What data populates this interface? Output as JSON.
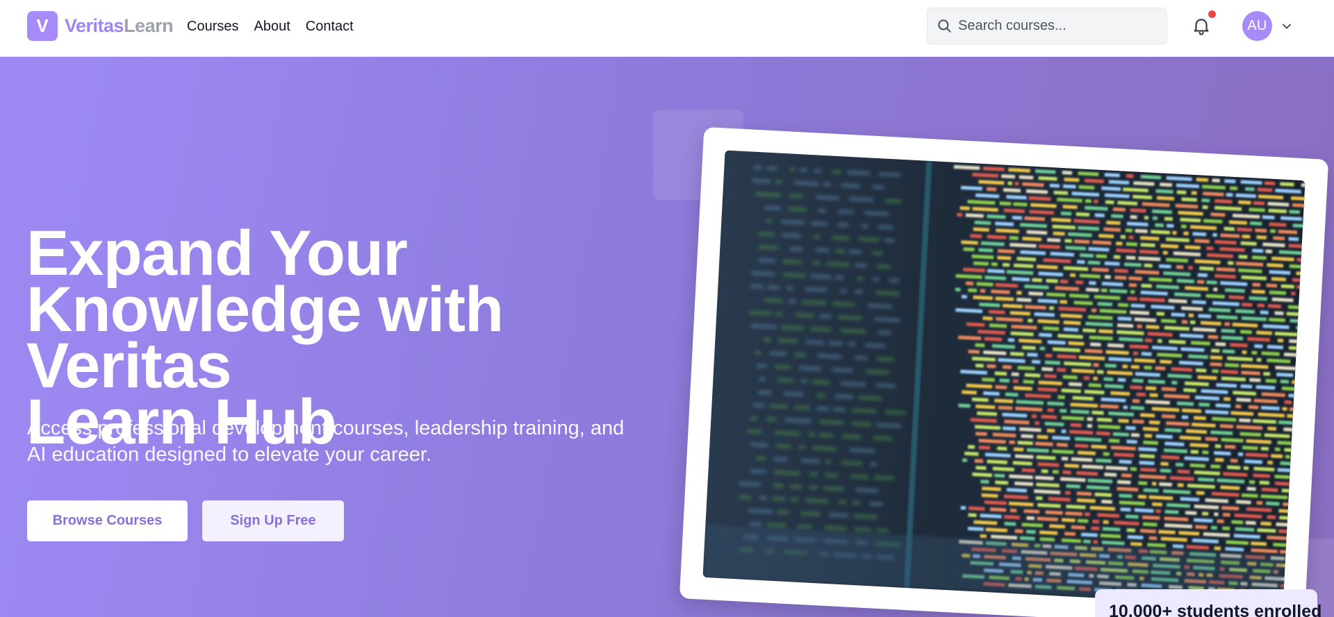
{
  "header": {
    "logo_letter": "V",
    "logo_part1": "Veritas",
    "logo_part2": "Learn",
    "nav": [
      "Courses",
      "About",
      "Contact"
    ],
    "search_placeholder": "Search courses...",
    "avatar_initials": "AU",
    "icons": [
      "search-icon",
      "bell-icon",
      "chevron-down-icon"
    ]
  },
  "hero": {
    "title_lines": [
      "Expand Your",
      "Knowledge with Veritas",
      "Learn Hub"
    ],
    "subtitle": "Access professional development courses, leadership training, and AI education designed to elevate your career.",
    "browse_label": "Browse Courses",
    "signup_label": "Sign Up Free",
    "stat_text": "10,000+ students enrolled"
  },
  "colors": {
    "accent": "#a78bfa",
    "accent_text": "#8b6fd8",
    "hero_start": "#9f8af5",
    "hero_end": "#8a6ec2",
    "notification": "#ef4444"
  }
}
